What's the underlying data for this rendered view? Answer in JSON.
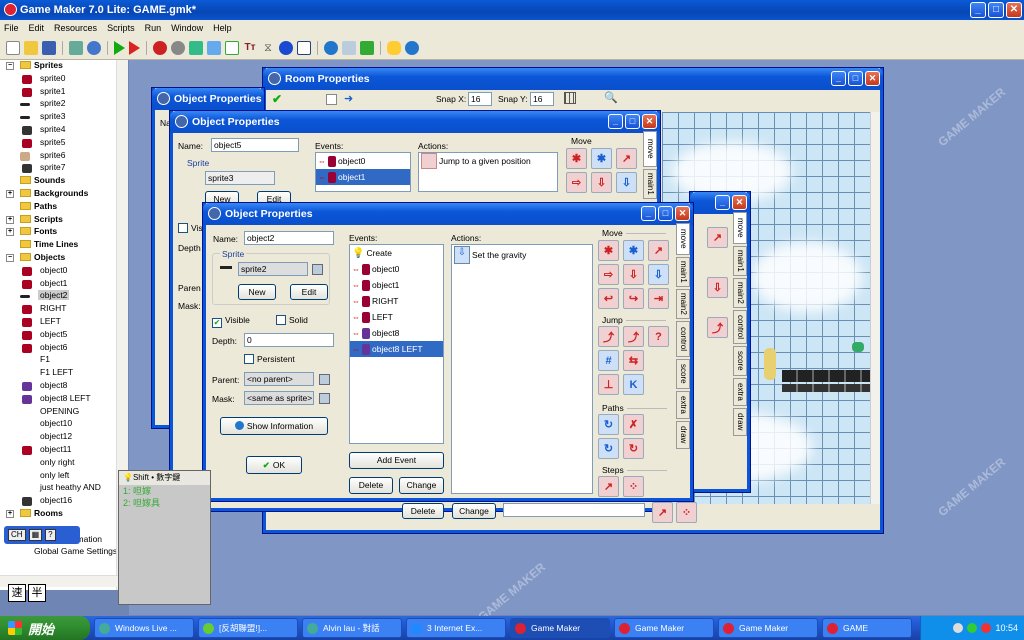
{
  "app": {
    "title": "Game Maker 7.0 Lite: GAME.gmk*",
    "min": "_",
    "max": "□",
    "close": "✕"
  },
  "menu": [
    "File",
    "Edit",
    "Resources",
    "Scripts",
    "Run",
    "Window",
    "Help"
  ],
  "tree": {
    "groups": {
      "sprites": "Sprites",
      "sounds": "Sounds",
      "backgrounds": "Backgrounds",
      "paths": "Paths",
      "scripts": "Scripts",
      "fonts": "Fonts",
      "timelines": "Time Lines",
      "objects": "Objects",
      "rooms": "Rooms"
    },
    "sprites": [
      "sprite0",
      "sprite1",
      "sprite2",
      "sprite3",
      "sprite4",
      "sprite5",
      "sprite6",
      "sprite7"
    ],
    "objects": [
      "object0",
      "object1",
      "object2",
      "RIGHT",
      "LEFT",
      "object5",
      "object6",
      "F1",
      "F1 LEFT",
      "object8",
      "object8 LEFT",
      "OPENING",
      "object10",
      "object12",
      "object11",
      "only right",
      "only left",
      "just heathy AND",
      "object16"
    ],
    "selected_object": "object2",
    "extras": [
      "Game Information",
      "Global Game Settings"
    ]
  },
  "room_props": {
    "title": "Room Properties",
    "snapx_label": "Snap X:",
    "snapx": "16",
    "snapy_label": "Snap Y:",
    "snapy": "16"
  },
  "obj_back": {
    "title": "Object Properties",
    "name_label": "Na"
  },
  "obj_mid": {
    "title": "Object Properties",
    "name_label": "Name:",
    "name": "object5",
    "sprite_label": "Sprite",
    "sprite": "sprite3",
    "new_btn": "New",
    "edit_btn": "Edit",
    "visible_label": "Visi",
    "depth_label": "Depth",
    "parent_label": "Paren",
    "mask_label": "Mask:",
    "events_label": "Events:",
    "events": [
      "object0",
      "object1"
    ],
    "actions_label": "Actions:",
    "action": "Jump to a given position",
    "move_label": "Move",
    "delete_btn": "Delete",
    "change_btn": "Change"
  },
  "obj_front": {
    "title": "Object Properties",
    "name_label": "Name:",
    "name": "object2",
    "sprite_label": "Sprite",
    "sprite": "sprite2",
    "new_btn": "New",
    "edit_btn": "Edit",
    "visible_label": "Visible",
    "solid_label": "Solid",
    "depth_label": "Depth:",
    "depth": "0",
    "persistent_label": "Persistent",
    "parent_label": "Parent:",
    "parent": "<no parent>",
    "mask_label": "Mask:",
    "mask": "<same as sprite>",
    "show_info_btn": "Show Information",
    "ok_btn": "OK",
    "events_label": "Events:",
    "events": [
      "Create",
      "object0",
      "object1",
      "RIGHT",
      "LEFT",
      "object8",
      "object8 LEFT"
    ],
    "selected_event": "object8 LEFT",
    "add_event_btn": "Add Event",
    "delete_btn": "Delete",
    "change_btn": "Change",
    "actions_label": "Actions:",
    "action": "Set the gravity",
    "groups": [
      "Move",
      "Jump",
      "Paths",
      "Steps"
    ],
    "tabs": [
      "move",
      "main1",
      "main2",
      "control",
      "score",
      "extra",
      "draw"
    ]
  },
  "mid_tabs": [
    "move",
    "main1"
  ],
  "room_tabs": [
    "move",
    "main1",
    "main2",
    "control",
    "score",
    "extra",
    "draw"
  ],
  "ime": {
    "header": "Shift • 數字鍵",
    "cand1": "1: 呾嫁",
    "cand2": "2: 呾嫁具",
    "lang": "CH",
    "blk1": "速",
    "blk2": "半"
  },
  "taskbar": {
    "start": "開始",
    "tasks": [
      "Windows Live ...",
      "[反胡聯盟!]...",
      "Alvin lau - 對話",
      "3 Internet Ex...",
      "Game Maker",
      "Game Maker",
      "Game Maker",
      "GAME"
    ],
    "active_task": "Game Maker",
    "clock": "10:54"
  },
  "watermark": "GAME MAKER",
  "colors": {
    "xp_blue": "#0b56d8",
    "face": "#ece9d8",
    "selection": "#316ac5"
  }
}
